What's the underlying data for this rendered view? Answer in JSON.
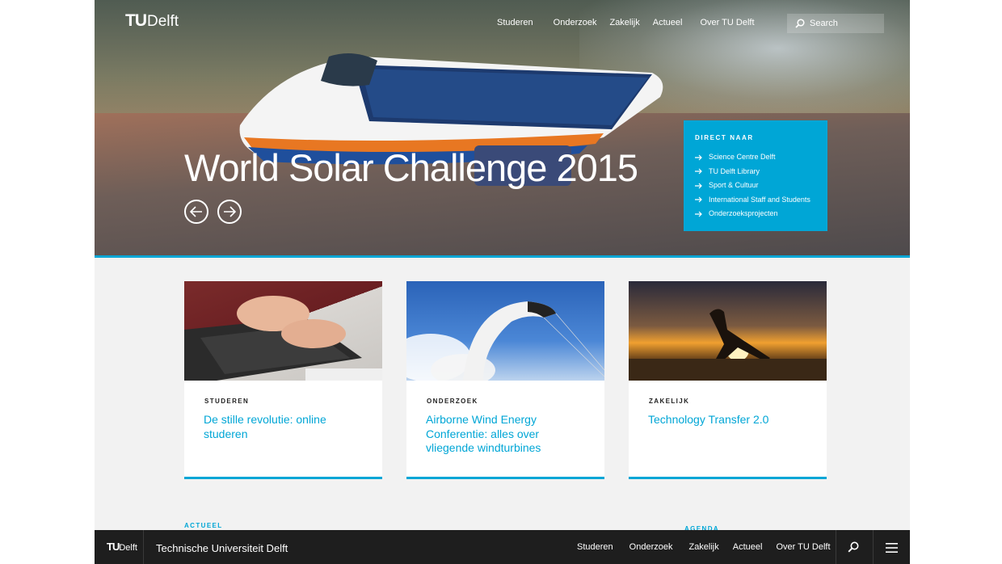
{
  "header": {
    "logo": {
      "tu": "TU",
      "delft": "Delft"
    },
    "nav": [
      "Studeren",
      "Onderzoek",
      "Zakelijk",
      "Actueel",
      "Over TU Delft"
    ],
    "search_placeholder": "Search"
  },
  "hero": {
    "title": "World Solar Challenge 2015",
    "prev_icon": "arrow-left-icon",
    "next_icon": "arrow-right-icon"
  },
  "direct_naar": {
    "heading": "DIRECT NAAR",
    "links": [
      "Science Centre Delft",
      "TU Delft Library",
      "Sport & Cultuur",
      "International Staff and Students",
      "Onderzoeksprojecten"
    ]
  },
  "cards": [
    {
      "category": "STUDEREN",
      "title": "De stille revolutie: online studeren"
    },
    {
      "category": "ONDERZOEK",
      "title": "Airborne Wind Energy Conferentie: alles over vliegende windturbines"
    },
    {
      "category": "ZAKELIJK",
      "title": "Technology Transfer 2.0"
    }
  ],
  "sections": {
    "actueel": "ACTUEEL",
    "agenda": "AGENDA"
  },
  "bottom_bar": {
    "logo": {
      "tu": "TU",
      "delft": "Delft"
    },
    "name": "Technische Universiteit Delft",
    "nav": [
      "Studeren",
      "Onderzoek",
      "Zakelijk",
      "Actueel",
      "Over TU Delft"
    ],
    "search_icon": "search-icon",
    "menu_icon": "hamburger-menu-icon"
  },
  "colors": {
    "accent": "#00a6d6",
    "bar": "#1e1e1e",
    "background": "#f2f2f2"
  }
}
